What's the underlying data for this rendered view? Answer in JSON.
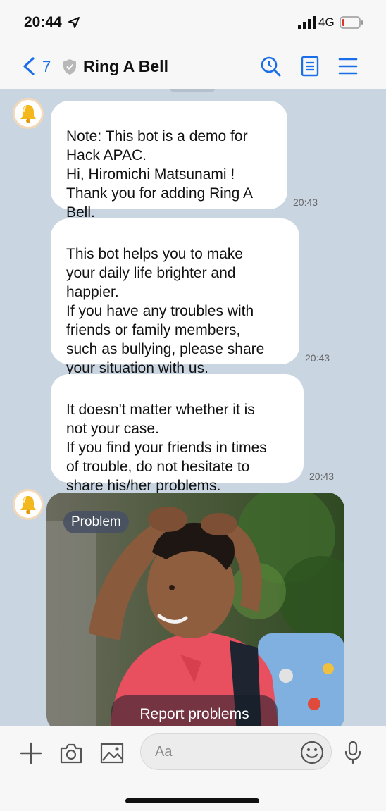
{
  "status_bar": {
    "time": "20:44",
    "network": "4G",
    "icons": [
      "location-arrow-icon",
      "signal-icon",
      "battery-icon"
    ]
  },
  "nav": {
    "back_count": "7",
    "title": "Ring A Bell",
    "icons": [
      "chevron-left-icon",
      "shield-icon",
      "search-icon",
      "notes-icon",
      "menu-icon"
    ],
    "accent": "#1a6fe8"
  },
  "messages": [
    {
      "text": "Note: This bot is a demo for\nHack APAC.\nHi, Hiromichi Matsunami !\nThank you for adding Ring A\nBell.",
      "time": "20:43"
    },
    {
      "text": "This bot helps you to make\nyour daily life brighter and\nhappier.\nIf you have any troubles with\nfriends or family members,\nsuch as bullying, please share\nyour situation with us.",
      "time": "20:43"
    },
    {
      "text": "It doesn't matter whether it is\nnot your case.\nIf you find your friends in times\nof trouble, do not hesitate to\nshare his/her problems.",
      "time": "20:43"
    }
  ],
  "card": {
    "badge": "Problem",
    "action": "Report problems"
  },
  "input_bar": {
    "placeholder": "Aa",
    "icons": [
      "plus-icon",
      "camera-icon",
      "image-icon",
      "emoji-icon",
      "microphone-icon"
    ]
  },
  "colors": {
    "chat_bg": "#c9d5e1",
    "bubble": "#ffffff",
    "bar": "#f7f7f7"
  }
}
